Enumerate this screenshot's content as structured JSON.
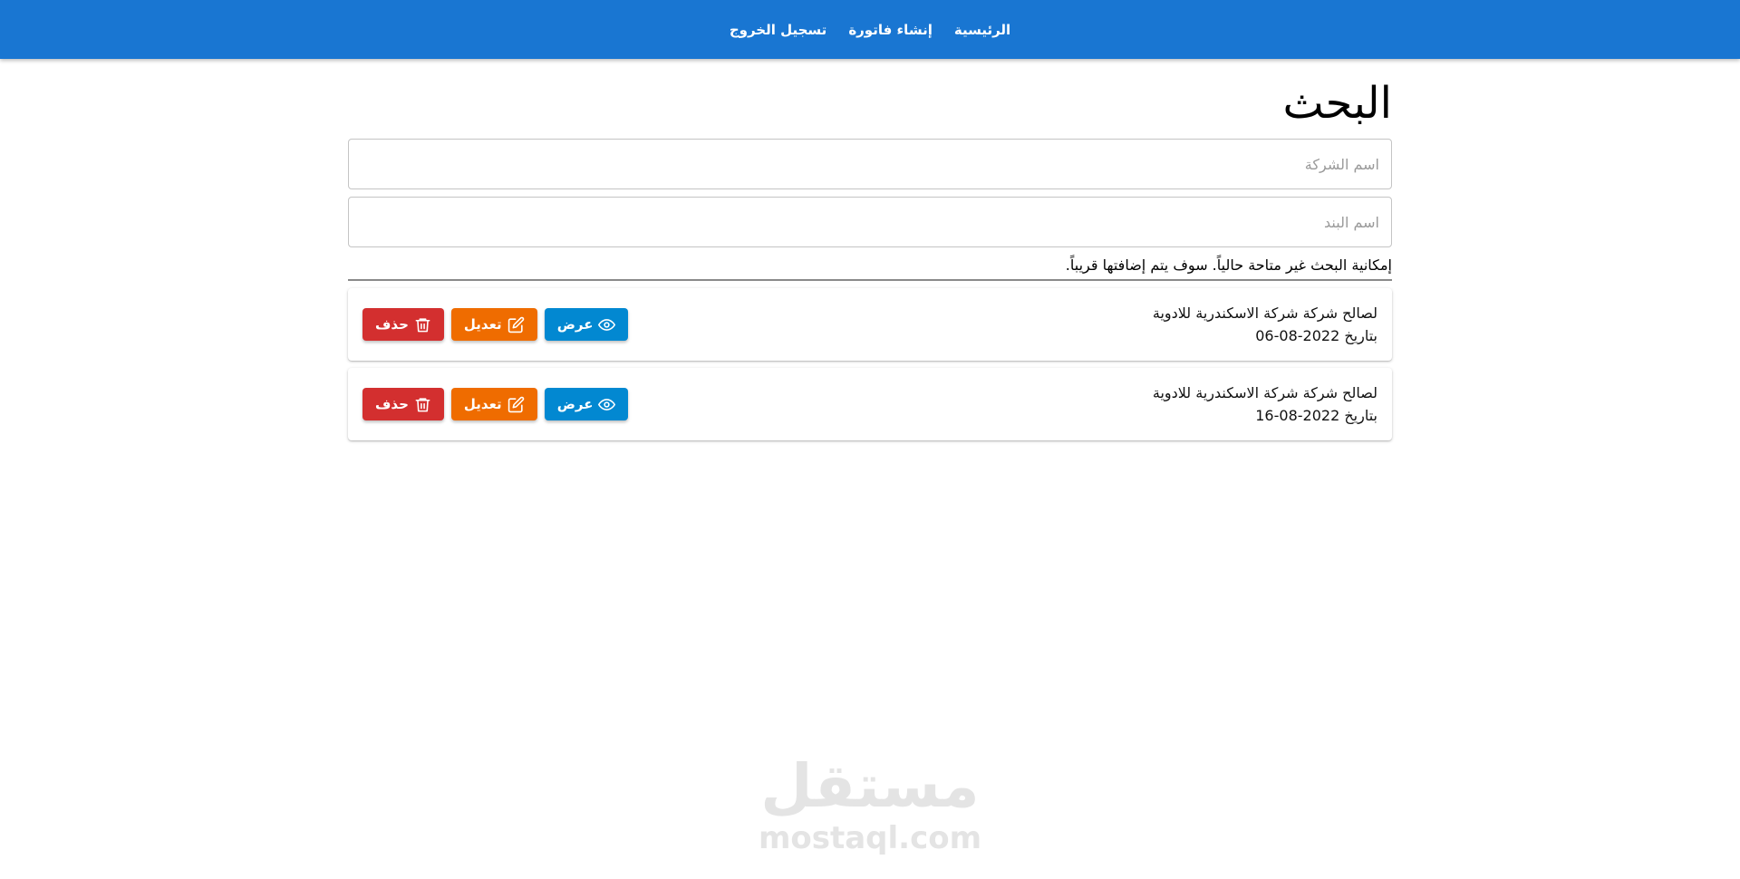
{
  "nav": {
    "home": "الرئيسية",
    "create_invoice": "إنشاء فاتورة",
    "logout": "تسجيل الخروج"
  },
  "page": {
    "title": "البحث"
  },
  "search": {
    "company_placeholder": "اسم الشركة",
    "item_placeholder": "اسم البند",
    "notice": "إمكانية البحث غير متاحة حالياً. سوف يتم إضافتها قريباً."
  },
  "invoices": [
    {
      "party": "لصالح شركة شركة الاسكندرية للادوية",
      "date": "بتاريخ 2022-08-06"
    },
    {
      "party": "لصالح شركة شركة الاسكندرية للادوية",
      "date": "بتاريخ 2022-08-16"
    }
  ],
  "actions": {
    "view": "عرض",
    "edit": "تعديل",
    "delete": "حذف"
  },
  "watermark": {
    "arabic": "مستقل",
    "latin": "mostaql.com"
  },
  "colors": {
    "header": "#1976d2",
    "view": "#0288d1",
    "edit": "#ef6c00",
    "delete": "#d32f2f"
  },
  "icons": {
    "view": "eye-icon",
    "edit": "edit-icon",
    "delete": "trash-icon"
  }
}
